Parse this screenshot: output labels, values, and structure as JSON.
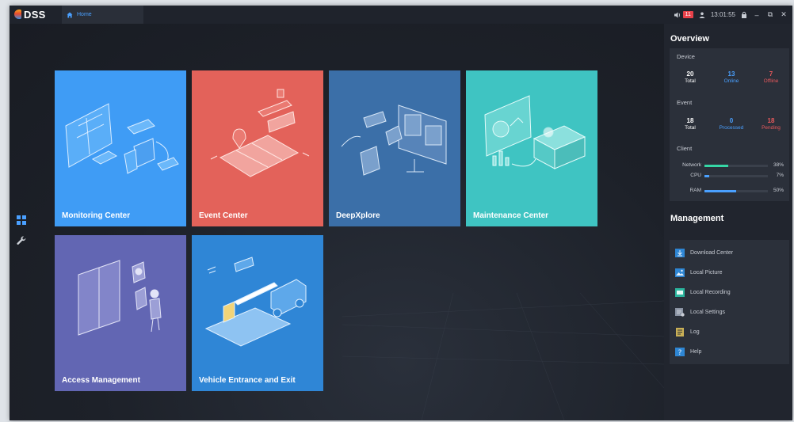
{
  "app": {
    "logo": "DSS"
  },
  "titlebar": {
    "home_tab": "Home",
    "alarm_count": "11",
    "time": "13:01:55"
  },
  "tiles": [
    {
      "label": "Monitoring Center",
      "color": "#3f9cf5"
    },
    {
      "label": "Event Center",
      "color": "#e3625a"
    },
    {
      "label": "DeepXplore",
      "color": "#3b6fa8"
    },
    {
      "label": "Maintenance Center",
      "color": "#3fc4c2"
    },
    {
      "label": "Access Management",
      "color": "#6266b3"
    },
    {
      "label": "Vehicle Entrance and Exit",
      "color": "#2f86d6"
    }
  ],
  "overview": {
    "title": "Overview",
    "device": {
      "title": "Device",
      "total": "20",
      "total_label": "Total",
      "online": "13",
      "online_label": "Online",
      "offline": "7",
      "offline_label": "Offline"
    },
    "event": {
      "title": "Event",
      "total": "18",
      "total_label": "Total",
      "processed": "0",
      "processed_label": "Processed",
      "pending": "18",
      "pending_label": "Pending"
    },
    "client": {
      "title": "Client",
      "network_label": "Network",
      "network_value": "38%",
      "network_level": 0.38,
      "cpu_label": "CPU",
      "cpu_value": "7%",
      "cpu_level": 0.07,
      "ram_label": "RAM",
      "ram_value": "50%",
      "ram_level": 0.5
    }
  },
  "management": {
    "title": "Management",
    "items": [
      {
        "label": "Download Center",
        "icon": "download-icon"
      },
      {
        "label": "Local Picture",
        "icon": "picture-icon"
      },
      {
        "label": "Local Recording",
        "icon": "recording-icon"
      },
      {
        "label": "Local Settings",
        "icon": "settings-icon"
      },
      {
        "label": "Log",
        "icon": "log-icon"
      },
      {
        "label": "Help",
        "icon": "help-icon"
      }
    ]
  },
  "colors": {
    "accent": "#4aa0ff",
    "online": "#4aa0ff",
    "offline": "#e8595c",
    "network_bar": "#35d6a5",
    "cpu_bar": "#4aa0ff",
    "ram_bar": "#4aa0ff"
  }
}
